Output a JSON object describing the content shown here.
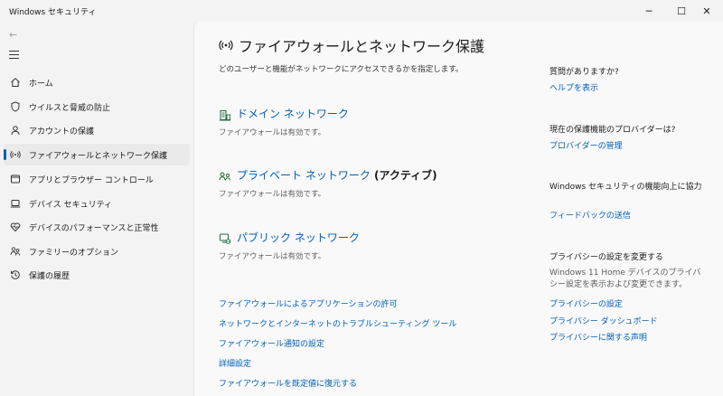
{
  "window": {
    "title": "Windows セキュリティ",
    "minimize": "─",
    "maximize": "☐",
    "close": "✕"
  },
  "sidebar": {
    "back": "←",
    "items": [
      {
        "label": "ホーム",
        "icon": "home-icon"
      },
      {
        "label": "ウイルスと脅威の防止",
        "icon": "shield-icon"
      },
      {
        "label": "アカウントの保護",
        "icon": "person-icon"
      },
      {
        "label": "ファイアウォールとネットワーク保護",
        "icon": "antenna-icon",
        "active": true
      },
      {
        "label": "アプリとブラウザー コントロール",
        "icon": "app-window-icon"
      },
      {
        "label": "デバイス セキュリティ",
        "icon": "laptop-icon"
      },
      {
        "label": "デバイスのパフォーマンスと正常性",
        "icon": "heart-pulse-icon"
      },
      {
        "label": "ファミリーのオプション",
        "icon": "family-icon"
      },
      {
        "label": "保護の履歴",
        "icon": "history-icon"
      }
    ]
  },
  "main": {
    "title": "ファイアウォールとネットワーク保護",
    "description": "どのユーザーと機能がネットワークにアクセスできるかを指定します。",
    "networks": [
      {
        "name": "ドメイン ネットワーク",
        "suffix": "",
        "status": "ファイアウォールは有効です。"
      },
      {
        "name": "プライベート ネットワーク",
        "suffix": " (アクティブ)",
        "status": "ファイアウォールは有効です。"
      },
      {
        "name": "パブリック ネットワーク",
        "suffix": "",
        "status": "ファイアウォールは有効です。"
      }
    ],
    "links": [
      "ファイアウォールによるアプリケーションの許可",
      "ネットワークとインターネットのトラブルシューティング ツール",
      "ファイアウォール通知の設定",
      "詳細設定",
      "ファイアウォールを既定値に復元する"
    ]
  },
  "right": {
    "help_heading": "質問がありますか?",
    "help_link": "ヘルプを表示",
    "provider_heading": "現在の保護機能のプロバイダーは?",
    "provider_link": "プロバイダーの管理",
    "improve_heading": "Windows セキュリティの機能向上に協力",
    "improve_link": "フィードバックの送信",
    "privacy_heading": "プライバシーの設定を変更する",
    "privacy_text": "Windows 11 Home デバイスのプライバシー設定を表示および変更できます。",
    "privacy_links": [
      "プライバシーの設定",
      "プライバシー ダッシュボード",
      "プライバシーに関する声明"
    ]
  },
  "colors": {
    "accent": "#005fb8",
    "background": "#f3f3f3",
    "content_bg": "#f9f9f9"
  }
}
